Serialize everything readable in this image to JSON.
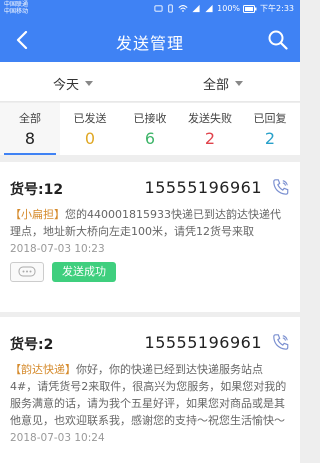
{
  "status_bar": {
    "carrier_1": "中国联通",
    "carrier_2": "中国移动",
    "battery": "100%",
    "time": "下午2:33"
  },
  "nav": {
    "title": "发送管理"
  },
  "filters": {
    "date": "今天",
    "status": "全部"
  },
  "tabs": [
    {
      "label": "全部",
      "count": "8",
      "color": "#222222",
      "active": true
    },
    {
      "label": "已发送",
      "count": "0",
      "color": "#e0a825"
    },
    {
      "label": "已接收",
      "count": "6",
      "color": "#3fb56a"
    },
    {
      "label": "发送失败",
      "count": "2",
      "color": "#e0434b"
    },
    {
      "label": "已回复",
      "count": "2",
      "color": "#27a0c9"
    }
  ],
  "records": [
    {
      "ticket": "货号:12",
      "phone": "15555196961",
      "signature": "【小扁担】",
      "message": "您的440001815933快递已到达韵达快递代理点，地址新大桥向左走100米，请凭12货号来取",
      "time": "2018-07-03 10:23",
      "status": "发送成功"
    },
    {
      "ticket": "货号:2",
      "phone": "15555196961",
      "signature": "【韵达快递】",
      "message": "你好，你的快递已经到达快递服务站点4#，请凭货号2来取件，很高兴为您服务，如果您对我的服务满意的话，请为我个五星好评，如果您对商品或是其他意见，也欢迎联系我，感谢您的支持～祝您生活愉快～",
      "time": "2018-07-03 10:24"
    }
  ],
  "colors": {
    "header": "#3f82f4",
    "success": "#3fcf7e",
    "signature": "#d58a2b"
  }
}
